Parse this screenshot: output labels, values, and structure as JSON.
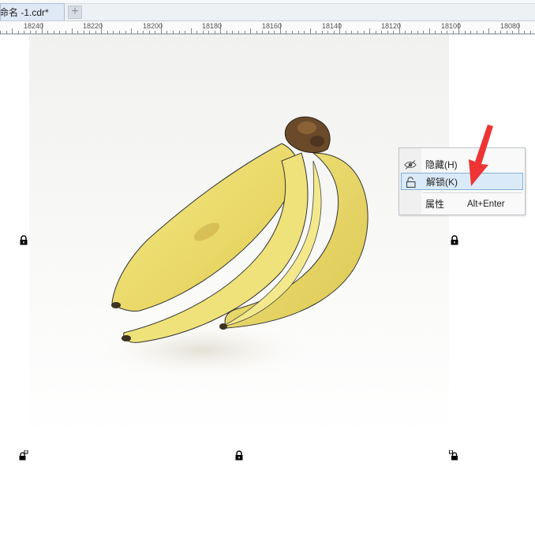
{
  "tabbar": {
    "document_tab": "命名 -1.cdr*",
    "add_tab": "+"
  },
  "ruler": {
    "labels": [
      "18240",
      "18220",
      "18200",
      "18180",
      "18160",
      "18140",
      "18120",
      "18100",
      "18080"
    ]
  },
  "context_menu": {
    "hide_label": "隐藏(H)",
    "unlock_label": "解锁(K)",
    "properties_label": "属性",
    "properties_shortcut": "Alt+Enter"
  },
  "colors": {
    "arrow": "#ee3434",
    "banana": "#ecdc70",
    "menu_highlight": "#dbeaf8"
  },
  "icons": {
    "hide": "eye-icon",
    "unlock": "unlock-icon",
    "lock_marker": "lock-icon"
  }
}
